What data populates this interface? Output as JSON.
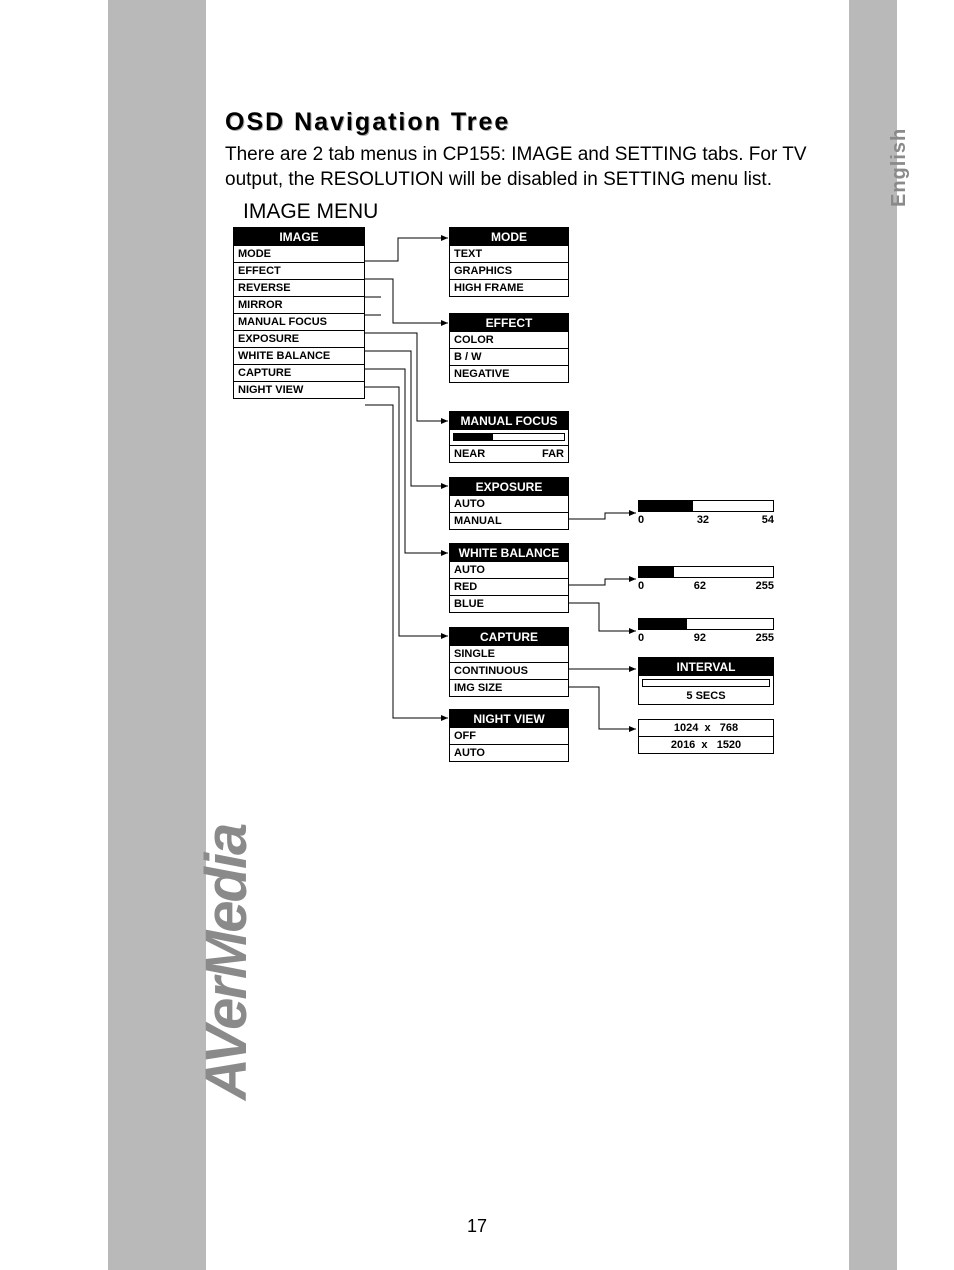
{
  "brand": "AVerMedia",
  "language": "English",
  "title": "OSD Navigation Tree",
  "description": "There are 2 tab menus in CP155: IMAGE and SETTING tabs. For TV output, the RESOLUTION will be disabled in SETTING menu list.",
  "subheading": "IMAGE MENU",
  "page_number": "17",
  "menu": {
    "image": {
      "header": "IMAGE",
      "items": [
        "MODE",
        "EFFECT",
        "REVERSE",
        "MIRROR",
        "MANUAL FOCUS",
        "EXPOSURE",
        "WHITE BALANCE",
        "CAPTURE",
        "NIGHT VIEW"
      ]
    },
    "mode": {
      "header": "MODE",
      "items": [
        "TEXT",
        "GRAPHICS",
        "HIGH FRAME"
      ]
    },
    "effect": {
      "header": "EFFECT",
      "items": [
        "COLOR",
        "B / W",
        "NEGATIVE"
      ]
    },
    "manual_focus": {
      "header": "MANUAL FOCUS",
      "near": "NEAR",
      "far": "FAR"
    },
    "exposure": {
      "header": "EXPOSURE",
      "items": [
        "AUTO",
        "MANUAL"
      ],
      "slider": {
        "min": "0",
        "val": "32",
        "max": "54"
      }
    },
    "white_balance": {
      "header": "WHITE BALANCE",
      "items": [
        "AUTO",
        "RED",
        "BLUE"
      ],
      "slider_red": {
        "min": "0",
        "val": "62",
        "max": "255"
      },
      "slider_blue": {
        "min": "0",
        "val": "92",
        "max": "255"
      }
    },
    "capture": {
      "header": "CAPTURE",
      "items": [
        "SINGLE",
        "CONTINUOUS",
        "IMG SIZE"
      ],
      "interval_header": "INTERVAL",
      "interval_val": "5 SECS",
      "res1": "1024  x   768",
      "res2": "2016  x   1520"
    },
    "night_view": {
      "header": "NIGHT VIEW",
      "items": [
        "OFF",
        "AUTO"
      ]
    }
  }
}
